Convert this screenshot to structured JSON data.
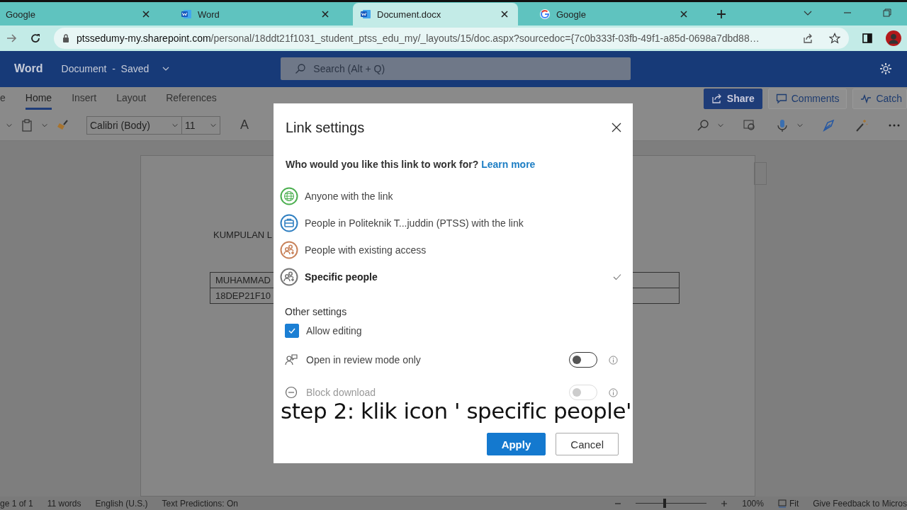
{
  "browser": {
    "tabs": [
      {
        "label": "Google",
        "kind": "plain",
        "selected": false
      },
      {
        "label": "Word",
        "kind": "word",
        "selected": false
      },
      {
        "label": "Document.docx",
        "kind": "word",
        "selected": true
      },
      {
        "label": "Google",
        "kind": "google",
        "selected": false
      }
    ],
    "url_host": "ptssedumy-my.sharepoint.com",
    "url_path": "/personal/18ddt21f1031_student_ptss_edu_my/_layouts/15/doc.aspx?sourcedoc={7c0b333f-03fb-49f1-a85d-0698a7dbd88…"
  },
  "app": {
    "name": "Word",
    "doc_title": "Document  -  Saved",
    "search_placeholder": "Search (Alt + Q)"
  },
  "ribbon": {
    "tabs": [
      {
        "label": "e",
        "selected": false
      },
      {
        "label": "Home",
        "selected": true
      },
      {
        "label": "Insert",
        "selected": false
      },
      {
        "label": "Layout",
        "selected": false
      },
      {
        "label": "References",
        "selected": false
      }
    ],
    "buttons": [
      {
        "label": "Share",
        "kind": "share"
      },
      {
        "label": "Comments",
        "kind": "comments"
      },
      {
        "label": "Catch",
        "kind": "catch"
      }
    ],
    "font": "Calibri (Body)",
    "size": "11",
    "grow_font": "A"
  },
  "document": {
    "heading": "KUMPULAN L",
    "table_rows": [
      "MUHAMMAD",
      "18DEP21F10"
    ]
  },
  "status_bar": {
    "items": [
      "ge 1 of 1",
      "11 words",
      "English (U.S.)",
      "Text Predictions: On"
    ],
    "zoom_slider": {
      "level": 0.4
    },
    "zoom": "100%",
    "fit": "Fit",
    "feedback": "Give Feedback to Micros"
  },
  "dialog": {
    "title": "Link settings",
    "question": "Who would you like this link to work for?",
    "learn_more": "Learn more",
    "options": [
      {
        "label": "Anyone with the link",
        "kind": "globe",
        "color": "#4caf50",
        "selected": false
      },
      {
        "label": "People in Politeknik T...juddin (PTSS) with the link",
        "kind": "briefcase",
        "color": "#2f7fc1",
        "selected": false
      },
      {
        "label": "People with existing access",
        "kind": "people",
        "color": "#c8825a",
        "selected": false
      },
      {
        "label": "Specific people",
        "kind": "people",
        "color": "#777777",
        "selected": true
      }
    ],
    "other_title": "Other settings",
    "allow_editing": {
      "label": "Allow editing",
      "checked": true
    },
    "toggles": [
      {
        "label": "Open in review mode only",
        "kind": "review",
        "on": false,
        "disabled": false
      },
      {
        "label": "Block download",
        "kind": "block",
        "on": false,
        "disabled": true
      }
    ],
    "buttons": [
      {
        "label": "Apply",
        "primary": true
      },
      {
        "label": "Cancel",
        "primary": false
      }
    ]
  },
  "caption": "step 2: klik icon ' specific people'"
}
